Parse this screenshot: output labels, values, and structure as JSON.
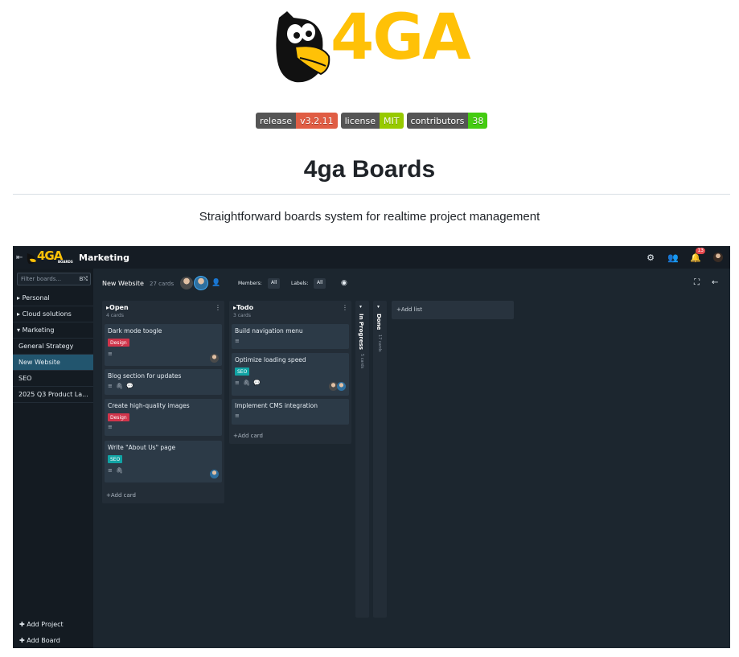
{
  "readme": {
    "logo_text": "4GA",
    "badges": [
      {
        "label": "release",
        "value": "v3.2.11",
        "color": "#e05d44"
      },
      {
        "label": "license",
        "value": "MIT",
        "color": "#97ca00"
      },
      {
        "label": "contributors",
        "value": "38",
        "color": "#44cc11"
      }
    ],
    "title": "4ga Boards",
    "subtitle": "Straightforward boards system for realtime project management"
  },
  "app": {
    "logo_text": "4GA",
    "logo_sub": "BOARDS",
    "project_title": "Marketing",
    "notification_count": "13",
    "sidebar": {
      "filter_placeholder": "Filter boards...",
      "items": [
        {
          "label": "Personal",
          "prefix": "▸"
        },
        {
          "label": "Cloud solutions",
          "prefix": "▸"
        },
        {
          "label": "Marketing",
          "prefix": "▾"
        },
        {
          "label": "General Strategy",
          "prefix": ""
        },
        {
          "label": "New Website",
          "prefix": ""
        },
        {
          "label": "SEO",
          "prefix": ""
        },
        {
          "label": "2025 Q3 Product La...",
          "prefix": ""
        }
      ],
      "add_project": "Add Project",
      "add_board": "Add Board"
    },
    "board": {
      "name": "New Website",
      "count": "27 cards",
      "members_label": "Members:",
      "members_value": "All",
      "labels_label": "Labels:",
      "labels_value": "All"
    },
    "lists": [
      {
        "title": "Open",
        "count": "4 cards",
        "cards": [
          {
            "title": "Dark mode toogle",
            "label": "Design"
          },
          {
            "title": "Blog section for updates",
            "icons": "≡ 🖇 💬"
          },
          {
            "title": "Create high-quality images",
            "label": "Design"
          },
          {
            "title": "Write \"About Us\" page",
            "label": "SEO",
            "icons": "≡ 🖇"
          }
        ],
        "add_card": "Add card"
      },
      {
        "title": "Todo",
        "count": "3 cards",
        "cards": [
          {
            "title": "Build navigation menu"
          },
          {
            "title": "Optimize loading speed",
            "label": "SEO",
            "icons": "≡ 🖇 💬"
          },
          {
            "title": "Implement CMS integration"
          }
        ],
        "add_card": "Add card"
      }
    ],
    "collapsed_lists": [
      {
        "title": "In Progress",
        "count": "5 cards"
      },
      {
        "title": "Done",
        "count": "17 cards"
      }
    ],
    "add_list": "Add list"
  }
}
